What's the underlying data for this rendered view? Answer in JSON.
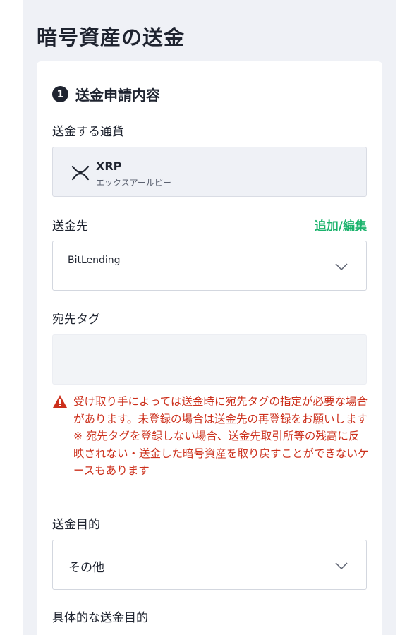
{
  "page": {
    "title": "暗号資産の送金"
  },
  "section": {
    "step": "1",
    "title": "送金申請内容"
  },
  "currency": {
    "label": "送金する通貨",
    "code": "XRP",
    "name": "エックスアールピー",
    "icon": "xrp-icon"
  },
  "destination": {
    "label": "送金先",
    "edit_link": "追加/編集",
    "selected": "BitLending"
  },
  "tag": {
    "label": "宛先タグ",
    "value": ""
  },
  "warning": {
    "icon": "warning-triangle-icon",
    "line1": "受け取り手によっては送金時に宛先タグの指定が必要な場合があります。未登録の場合は送金先の再登録をお願いします",
    "line2": "※ 宛先タグを登録しない場合、送金先取引所等の残高に反映されない・送金した暗号資産を取り戻すことができないケースもあります"
  },
  "purpose": {
    "label": "送金目的",
    "selected": "その他"
  },
  "purpose_detail": {
    "label": "具体的な送金目的"
  },
  "colors": {
    "accent_green": "#1ab36c",
    "warning_red": "#cc2f1b",
    "background": "#eff1f6"
  }
}
